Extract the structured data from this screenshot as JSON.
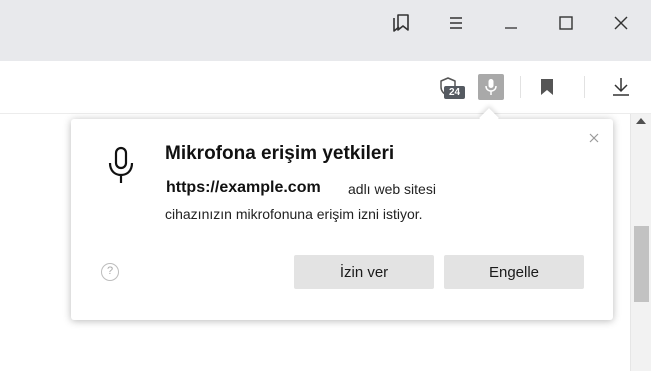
{
  "titlebar": {
    "icons": [
      "bookmarks-panel-icon",
      "menu-icon",
      "minimize-icon",
      "maximize-icon",
      "close-icon"
    ]
  },
  "toolbar": {
    "shield_badge": "24",
    "icons": [
      "shield-icon",
      "microphone-icon",
      "bookmark-icon",
      "download-icon"
    ]
  },
  "popup": {
    "title": "Mikrofona erişim yetkileri",
    "site": "https://example.com",
    "message_line1": "adlı web sitesi",
    "message_line2": "cihazınızın mikrofonuna erişim izni istiyor.",
    "help_glyph": "?",
    "allow_label": "İzin ver",
    "block_label": "Engelle"
  },
  "colors": {
    "titlebar_bg": "#e8e9ec",
    "button_bg": "#e3e3e3",
    "mic_active_bg": "#a9a9a9",
    "badge_bg": "#555a61"
  }
}
